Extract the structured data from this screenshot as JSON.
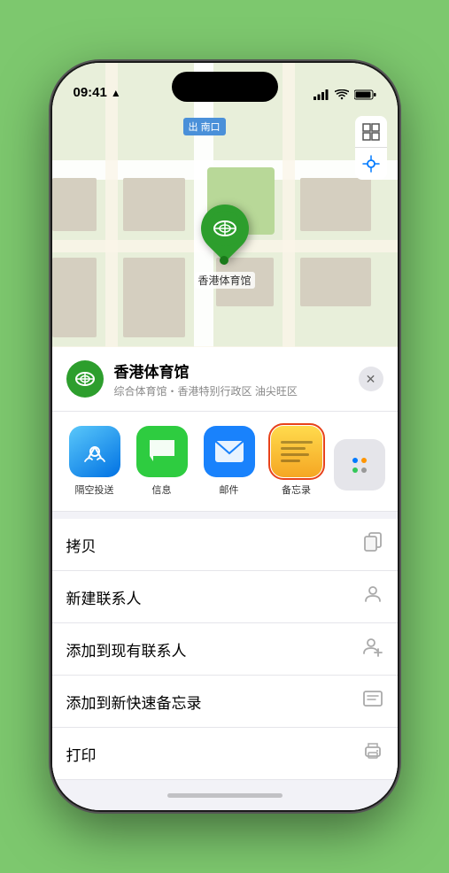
{
  "status_bar": {
    "time": "09:41",
    "location_arrow": "▶"
  },
  "map": {
    "label": "南口",
    "label_prefix": "出",
    "pin_label": "香港体育馆",
    "controls": {
      "map_btn": "⊞",
      "location_btn": "◎"
    }
  },
  "place_card": {
    "name": "香港体育馆",
    "subtitle": "综合体育馆・香港特别行政区 油尖旺区",
    "close_label": "✕"
  },
  "share_items": [
    {
      "id": "airdrop",
      "label": "隔空投送"
    },
    {
      "id": "message",
      "label": "信息"
    },
    {
      "id": "mail",
      "label": "邮件"
    },
    {
      "id": "notes",
      "label": "备忘录"
    }
  ],
  "action_items": [
    {
      "id": "copy",
      "label": "拷贝",
      "icon": "copy"
    },
    {
      "id": "new-contact",
      "label": "新建联系人",
      "icon": "person"
    },
    {
      "id": "add-contact",
      "label": "添加到现有联系人",
      "icon": "person-add"
    },
    {
      "id": "quick-note",
      "label": "添加到新快速备忘录",
      "icon": "note"
    },
    {
      "id": "print",
      "label": "打印",
      "icon": "printer"
    }
  ]
}
